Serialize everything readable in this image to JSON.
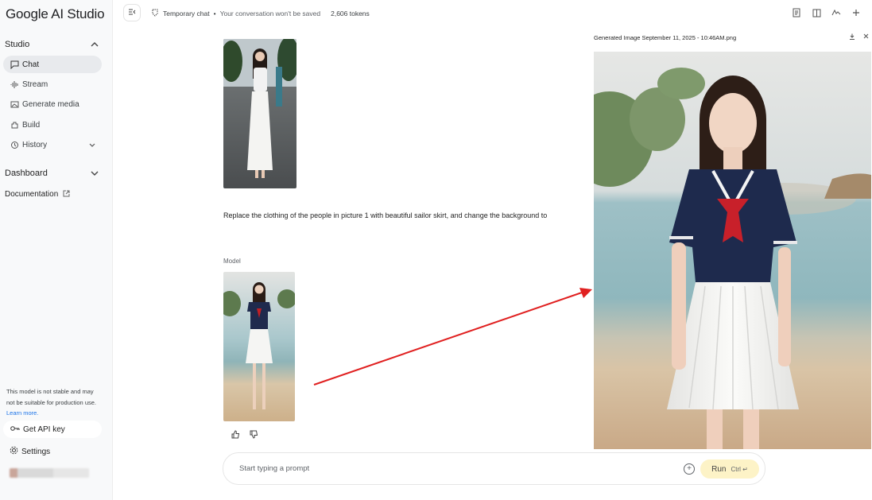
{
  "app": {
    "title": "Google AI Studio"
  },
  "sidebar": {
    "studio_label": "Studio",
    "items": [
      {
        "label": "Chat",
        "icon": "chat-icon"
      },
      {
        "label": "Stream",
        "icon": "stream-icon"
      },
      {
        "label": "Generate media",
        "icon": "media-icon"
      },
      {
        "label": "Build",
        "icon": "build-icon"
      },
      {
        "label": "History",
        "icon": "history-icon"
      }
    ],
    "dashboard_label": "Dashboard",
    "documentation_label": "Documentation",
    "notice_text": "This model is not stable and may not be suitable for production use.",
    "learn_more": "Learn more.",
    "api_key_label": "Get API key",
    "settings_label": "Settings"
  },
  "topbar": {
    "temp_chat_label": "Temporary chat",
    "temp_chat_note": "Your conversation won't be saved",
    "tokens": "2,606 tokens"
  },
  "chat": {
    "user_prompt": "Replace the clothing of the people in picture 1 with beautiful sailor skirt, and change the background to",
    "model_label": "Model"
  },
  "input": {
    "placeholder": "Start typing a prompt",
    "run_label": "Run",
    "shortcut": "Ctrl"
  },
  "preview": {
    "title": "Generated Image September 11, 2025 - 10:46AM.png"
  },
  "colors": {
    "accent": "#1a73e8",
    "run_bg": "#fdf3c7",
    "arrow": "#e02020"
  }
}
